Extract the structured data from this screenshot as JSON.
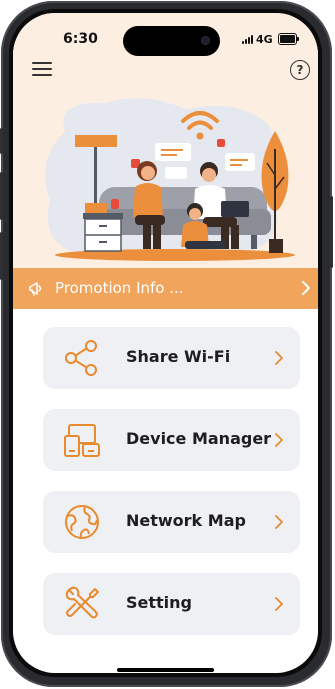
{
  "status_bar": {
    "time": "6:30",
    "network": "4G"
  },
  "header": {
    "menu_icon": "hamburger-menu-icon",
    "help_icon": "question-mark-icon",
    "help_glyph": "?"
  },
  "illustration": {
    "icon": "family-home-wifi-illustration"
  },
  "promo": {
    "label": "Promotion Info ...",
    "icon": "megaphone-icon",
    "chevron_icon": "chevron-right-icon"
  },
  "menu": [
    {
      "label": "Share Wi-Fi",
      "icon": "share-icon"
    },
    {
      "label": "Device Manager",
      "icon": "devices-icon"
    },
    {
      "label": "Network Map",
      "icon": "globe-icon"
    },
    {
      "label": "Setting",
      "icon": "wrench-screwdriver-icon"
    }
  ],
  "colors": {
    "accent": "#f0a45c",
    "icon_orange": "#e98a2e",
    "header_bg": "#fdeee2",
    "button_bg": "#eef0f4"
  }
}
